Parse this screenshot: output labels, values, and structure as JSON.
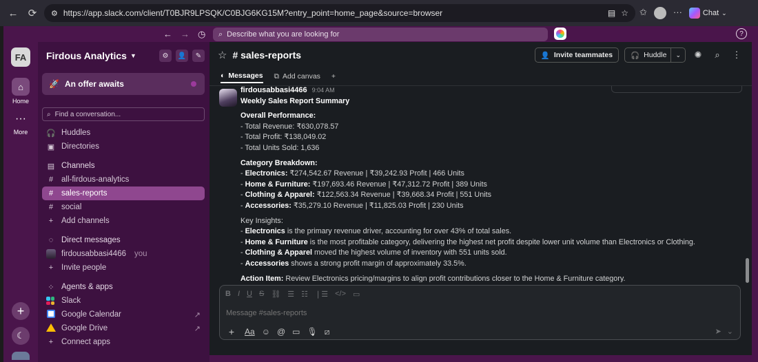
{
  "browser": {
    "url": "https://app.slack.com/client/T0BJR9LPSQK/C0BJG6KG15M?entry_point=home_page&source=browser",
    "chat_label": "Chat"
  },
  "topbar": {
    "search_placeholder": "Describe what you are looking for"
  },
  "rail": {
    "workspace_initials": "FA",
    "home_label": "Home",
    "more_label": "More"
  },
  "sidebar": {
    "workspace_name": "Firdous Analytics",
    "offer_label": "An offer awaits",
    "find_placeholder": "Find a conversation...",
    "huddles": "Huddles",
    "directories": "Directories",
    "channels_header": "Channels",
    "channels": [
      "all-firdous-analytics",
      "sales-reports",
      "social"
    ],
    "add_channels": "Add channels",
    "dm_header": "Direct messages",
    "dm_user": "firdousabbasi4466",
    "dm_you": "you",
    "invite_people": "Invite people",
    "apps_header": "Agents & apps",
    "apps": [
      "Slack",
      "Google Calendar",
      "Google Drive"
    ],
    "connect_apps": "Connect apps"
  },
  "channel": {
    "name": "sales-reports",
    "invite_label": "Invite teammates",
    "huddle_label": "Huddle",
    "tabs": [
      "Messages",
      "Add canvas"
    ]
  },
  "message": {
    "author": "firdousabbasi4466",
    "time": "9:04 AM",
    "title": "Weekly Sales Report Summary",
    "overall_header": "Overall Performance:",
    "overall": [
      "- Total Revenue: ₹630,078.57",
      "- Total Profit: ₹138,049.02",
      "- Total Units Sold: 1,636"
    ],
    "category_header": "Category Breakdown:",
    "categories": [
      {
        "name": "Electronics:",
        "text": " ₹274,542.67 Revenue | ₹39,242.93 Profit | 466 Units"
      },
      {
        "name": "Home & Furniture:",
        "text": " ₹197,693.46 Revenue | ₹47,312.72 Profit | 389 Units"
      },
      {
        "name": "Clothing & Apparel:",
        "text": " ₹122,563.34 Revenue | ₹39,668.34 Profit | 551 Units"
      },
      {
        "name": "Accessories:",
        "text": " ₹35,279.10 Revenue | ₹11,825.03 Profit | 230 Units"
      }
    ],
    "insights_header": "Key Insights:",
    "insights": [
      {
        "name": "Electronics",
        "text": " is the primary revenue driver, accounting for over 43% of total sales."
      },
      {
        "name": "Home & Furniture",
        "text": " is the most profitable category, delivering the highest net profit despite lower unit volume than Electronics or Clothing."
      },
      {
        "name": "Clothing & Apparel",
        "text": " moved the highest volume of inventory with 551 units sold."
      },
      {
        "name": "Accessories",
        "text": " shows a strong profit margin of approximately 33.5%."
      }
    ],
    "action_label": "Action Item:",
    "action_text": " Review Electronics pricing/margins to align profit contributions closer to the Home & Furniture category."
  },
  "composer": {
    "placeholder": "Message #sales-reports"
  },
  "colors": {
    "aubergine": "#4a154b",
    "sidebar": "#3d1140",
    "selected": "#8f478f",
    "main_bg": "#1a1d21"
  }
}
